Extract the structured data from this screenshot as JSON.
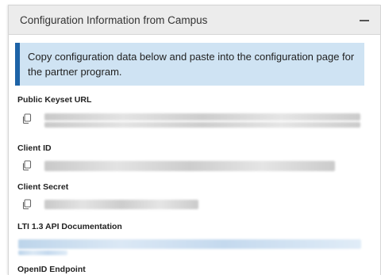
{
  "panel": {
    "title": "Configuration Information from Campus",
    "collapse_icon": "minus-icon"
  },
  "banner": {
    "text": "Copy configuration data below and paste into the configuration page for the partner program."
  },
  "fields": [
    {
      "label": "Public Keyset URL",
      "icon": "copy-icon"
    },
    {
      "label": "Client ID",
      "icon": "copy-icon"
    },
    {
      "label": "Client Secret",
      "icon": "copy-icon"
    },
    {
      "label": "LTI 1.3 API Documentation"
    },
    {
      "label": "OpenID Endpoint"
    }
  ],
  "colors": {
    "banner_accent": "#1d63a7",
    "banner_background": "#cfe3f3",
    "header_background": "#ececec"
  }
}
